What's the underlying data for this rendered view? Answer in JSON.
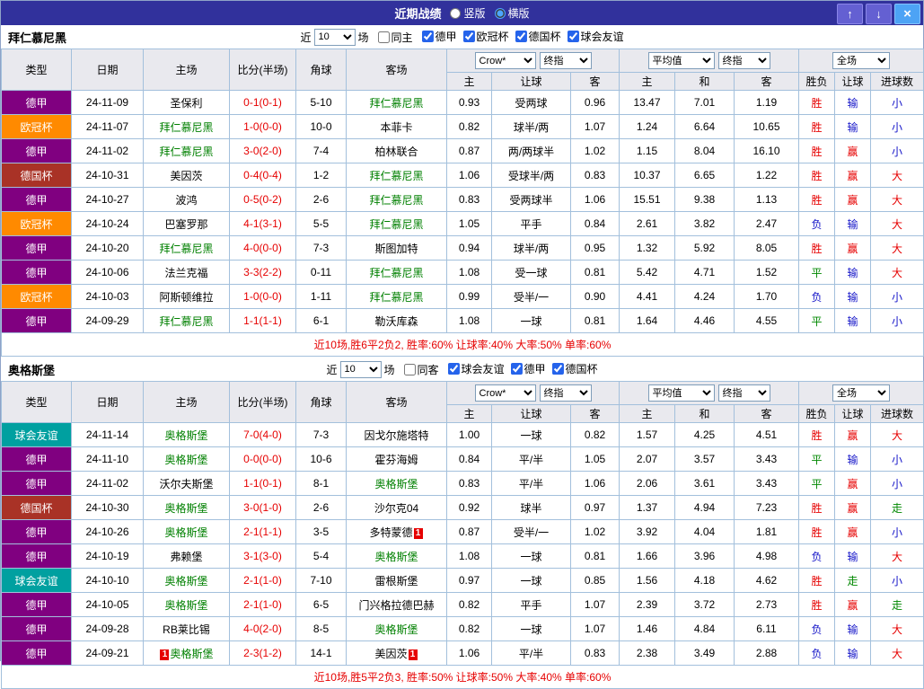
{
  "title_bar": {
    "title": "近期战绩",
    "vertical_label": "竖版",
    "horizontal_label": "横版",
    "selected_layout": "横版",
    "up_icon": "↑",
    "down_icon": "↓",
    "close_icon": "×"
  },
  "colors": {
    "titlebar_bg": "#31319c",
    "score": "#e60000",
    "focus_team": "#008000",
    "summary": "#e60000",
    "league": {
      "德甲": "#800080",
      "欧冠杯": "#ff8a00",
      "德国杯": "#a93226",
      "球会友谊": "#00a0a0"
    },
    "result": {
      "胜": "#e60000",
      "平": "#008800",
      "负": "#1414c8",
      "赢": "#e60000",
      "输": "#1414c8",
      "走": "#008800",
      "大": "#e60000",
      "小": "#1414c8"
    }
  },
  "sections": [
    {
      "team": "拜仁慕尼黑",
      "filter": {
        "near_label": "近",
        "count": "10",
        "games_label": "场",
        "same_label": "同主",
        "same_checked": false,
        "leagues": [
          {
            "label": "德甲",
            "checked": true
          },
          {
            "label": "欧冠杯",
            "checked": true
          },
          {
            "label": "德国杯",
            "checked": true
          },
          {
            "label": "球会友谊",
            "checked": true
          }
        ]
      },
      "header": {
        "main_cols": [
          "类型",
          "日期",
          "主场",
          "比分(半场)",
          "角球",
          "客场"
        ],
        "odds_group1": {
          "source": "Crow*",
          "type": "终指",
          "sub_cols": [
            "主",
            "让球",
            "客"
          ]
        },
        "odds_group2": {
          "source": "平均值",
          "type": "终指",
          "sub_cols": [
            "主",
            "和",
            "客"
          ]
        },
        "result_group": {
          "scope": "全场",
          "sub_cols": [
            "胜负",
            "让球",
            "进球数"
          ]
        }
      },
      "rows": [
        {
          "league": "德甲",
          "date": "24-11-09",
          "home": "圣保利",
          "score": "0-1(0-1)",
          "corner": "5-10",
          "away": "拜仁慕尼黑",
          "o1": "0.93",
          "handicap": "受两球",
          "o2": "0.96",
          "avg_home": "13.47",
          "avg_draw": "7.01",
          "avg_away": "1.19",
          "outcome": "胜",
          "handicap_result": "输",
          "goals_result": "小"
        },
        {
          "league": "欧冠杯",
          "date": "24-11-07",
          "home": "拜仁慕尼黑",
          "score": "1-0(0-0)",
          "corner": "10-0",
          "away": "本菲卡",
          "o1": "0.82",
          "handicap": "球半/两",
          "o2": "1.07",
          "avg_home": "1.24",
          "avg_draw": "6.64",
          "avg_away": "10.65",
          "outcome": "胜",
          "handicap_result": "输",
          "goals_result": "小"
        },
        {
          "league": "德甲",
          "date": "24-11-02",
          "home": "拜仁慕尼黑",
          "score": "3-0(2-0)",
          "corner": "7-4",
          "away": "柏林联合",
          "o1": "0.87",
          "handicap": "两/两球半",
          "o2": "1.02",
          "avg_home": "1.15",
          "avg_draw": "8.04",
          "avg_away": "16.10",
          "outcome": "胜",
          "handicap_result": "赢",
          "goals_result": "小"
        },
        {
          "league": "德国杯",
          "date": "24-10-31",
          "home": "美因茨",
          "score": "0-4(0-4)",
          "corner": "1-2",
          "away": "拜仁慕尼黑",
          "o1": "1.06",
          "handicap": "受球半/两",
          "o2": "0.83",
          "avg_home": "10.37",
          "avg_draw": "6.65",
          "avg_away": "1.22",
          "outcome": "胜",
          "handicap_result": "赢",
          "goals_result": "大"
        },
        {
          "league": "德甲",
          "date": "24-10-27",
          "home": "波鸿",
          "score": "0-5(0-2)",
          "corner": "2-6",
          "away": "拜仁慕尼黑",
          "o1": "0.83",
          "handicap": "受两球半",
          "o2": "1.06",
          "avg_home": "15.51",
          "avg_draw": "9.38",
          "avg_away": "1.13",
          "outcome": "胜",
          "handicap_result": "赢",
          "goals_result": "大"
        },
        {
          "league": "欧冠杯",
          "date": "24-10-24",
          "home": "巴塞罗那",
          "score": "4-1(3-1)",
          "corner": "5-5",
          "away": "拜仁慕尼黑",
          "o1": "1.05",
          "handicap": "平手",
          "o2": "0.84",
          "avg_home": "2.61",
          "avg_draw": "3.82",
          "avg_away": "2.47",
          "outcome": "负",
          "handicap_result": "输",
          "goals_result": "大"
        },
        {
          "league": "德甲",
          "date": "24-10-20",
          "home": "拜仁慕尼黑",
          "score": "4-0(0-0)",
          "corner": "7-3",
          "away": "斯图加特",
          "o1": "0.94",
          "handicap": "球半/两",
          "o2": "0.95",
          "avg_home": "1.32",
          "avg_draw": "5.92",
          "avg_away": "8.05",
          "outcome": "胜",
          "handicap_result": "赢",
          "goals_result": "大"
        },
        {
          "league": "德甲",
          "date": "24-10-06",
          "home": "法兰克福",
          "score": "3-3(2-2)",
          "corner": "0-11",
          "away": "拜仁慕尼黑",
          "o1": "1.08",
          "handicap": "受一球",
          "o2": "0.81",
          "avg_home": "5.42",
          "avg_draw": "4.71",
          "avg_away": "1.52",
          "outcome": "平",
          "handicap_result": "输",
          "goals_result": "大"
        },
        {
          "league": "欧冠杯",
          "date": "24-10-03",
          "home": "阿斯顿维拉",
          "score": "1-0(0-0)",
          "corner": "1-11",
          "away": "拜仁慕尼黑",
          "o1": "0.99",
          "handicap": "受半/一",
          "o2": "0.90",
          "avg_home": "4.41",
          "avg_draw": "4.24",
          "avg_away": "1.70",
          "outcome": "负",
          "handicap_result": "输",
          "goals_result": "小"
        },
        {
          "league": "德甲",
          "date": "24-09-29",
          "home": "拜仁慕尼黑",
          "score": "1-1(1-1)",
          "corner": "6-1",
          "away": "勒沃库森",
          "o1": "1.08",
          "handicap": "一球",
          "o2": "0.81",
          "avg_home": "1.64",
          "avg_draw": "4.46",
          "avg_away": "4.55",
          "outcome": "平",
          "handicap_result": "输",
          "goals_result": "小"
        }
      ],
      "summary": "近10场,胜6平2负2, 胜率:60% 让球率:40% 大率:50% 单率:60%"
    },
    {
      "team": "奥格斯堡",
      "filter": {
        "near_label": "近",
        "count": "10",
        "games_label": "场",
        "same_label": "同客",
        "same_checked": false,
        "leagues": [
          {
            "label": "球会友谊",
            "checked": true
          },
          {
            "label": "德甲",
            "checked": true
          },
          {
            "label": "德国杯",
            "checked": true
          }
        ]
      },
      "header": {
        "main_cols": [
          "类型",
          "日期",
          "主场",
          "比分(半场)",
          "角球",
          "客场"
        ],
        "odds_group1": {
          "source": "Crow*",
          "type": "终指",
          "sub_cols": [
            "主",
            "让球",
            "客"
          ]
        },
        "odds_group2": {
          "source": "平均值",
          "type": "终指",
          "sub_cols": [
            "主",
            "和",
            "客"
          ]
        },
        "result_group": {
          "scope": "全场",
          "sub_cols": [
            "胜负",
            "让球",
            "进球数"
          ]
        }
      },
      "rows": [
        {
          "league": "球会友谊",
          "date": "24-11-14",
          "home": "奥格斯堡",
          "score": "7-0(4-0)",
          "corner": "7-3",
          "away": "因戈尔施塔特",
          "o1": "1.00",
          "handicap": "一球",
          "o2": "0.82",
          "avg_home": "1.57",
          "avg_draw": "4.25",
          "avg_away": "4.51",
          "outcome": "胜",
          "handicap_result": "赢",
          "goals_result": "大"
        },
        {
          "league": "德甲",
          "date": "24-11-10",
          "home": "奥格斯堡",
          "score": "0-0(0-0)",
          "corner": "10-6",
          "away": "霍芬海姆",
          "o1": "0.84",
          "handicap": "平/半",
          "o2": "1.05",
          "avg_home": "2.07",
          "avg_draw": "3.57",
          "avg_away": "3.43",
          "outcome": "平",
          "handicap_result": "输",
          "goals_result": "小"
        },
        {
          "league": "德甲",
          "date": "24-11-02",
          "home": "沃尔夫斯堡",
          "score": "1-1(0-1)",
          "corner": "8-1",
          "away": "奥格斯堡",
          "o1": "0.83",
          "handicap": "平/半",
          "o2": "1.06",
          "avg_home": "2.06",
          "avg_draw": "3.61",
          "avg_away": "3.43",
          "outcome": "平",
          "handicap_result": "赢",
          "goals_result": "小"
        },
        {
          "league": "德国杯",
          "date": "24-10-30",
          "home": "奥格斯堡",
          "score": "3-0(1-0)",
          "corner": "2-6",
          "away": "沙尔克04",
          "o1": "0.92",
          "handicap": "球半",
          "o2": "0.97",
          "avg_home": "1.37",
          "avg_draw": "4.94",
          "avg_away": "7.23",
          "outcome": "胜",
          "handicap_result": "赢",
          "goals_result": "走"
        },
        {
          "league": "德甲",
          "date": "24-10-26",
          "home": "奥格斯堡",
          "score": "2-1(1-1)",
          "corner": "3-5",
          "away": "多特蒙德",
          "away_card": "1",
          "o1": "0.87",
          "handicap": "受半/一",
          "o2": "1.02",
          "avg_home": "3.92",
          "avg_draw": "4.04",
          "avg_away": "1.81",
          "outcome": "胜",
          "handicap_result": "赢",
          "goals_result": "小"
        },
        {
          "league": "德甲",
          "date": "24-10-19",
          "home": "弗赖堡",
          "score": "3-1(3-0)",
          "corner": "5-4",
          "away": "奥格斯堡",
          "o1": "1.08",
          "handicap": "一球",
          "o2": "0.81",
          "avg_home": "1.66",
          "avg_draw": "3.96",
          "avg_away": "4.98",
          "outcome": "负",
          "handicap_result": "输",
          "goals_result": "大"
        },
        {
          "league": "球会友谊",
          "date": "24-10-10",
          "home": "奥格斯堡",
          "score": "2-1(1-0)",
          "corner": "7-10",
          "away": "雷根斯堡",
          "o1": "0.97",
          "handicap": "一球",
          "o2": "0.85",
          "avg_home": "1.56",
          "avg_draw": "4.18",
          "avg_away": "4.62",
          "outcome": "胜",
          "handicap_result": "走",
          "goals_result": "小"
        },
        {
          "league": "德甲",
          "date": "24-10-05",
          "home": "奥格斯堡",
          "score": "2-1(1-0)",
          "corner": "6-5",
          "away": "门兴格拉德巴赫",
          "o1": "0.82",
          "handicap": "平手",
          "o2": "1.07",
          "avg_home": "2.39",
          "avg_draw": "3.72",
          "avg_away": "2.73",
          "outcome": "胜",
          "handicap_result": "赢",
          "goals_result": "走"
        },
        {
          "league": "德甲",
          "date": "24-09-28",
          "home": "RB莱比锡",
          "score": "4-0(2-0)",
          "corner": "8-5",
          "away": "奥格斯堡",
          "o1": "0.82",
          "handicap": "一球",
          "o2": "1.07",
          "avg_home": "1.46",
          "avg_draw": "4.84",
          "avg_away": "6.11",
          "outcome": "负",
          "handicap_result": "输",
          "goals_result": "大"
        },
        {
          "league": "德甲",
          "date": "24-09-21",
          "home": "奥格斯堡",
          "home_card": "1",
          "score": "2-3(1-2)",
          "corner": "14-1",
          "away": "美因茨",
          "away_card": "1",
          "o1": "1.06",
          "handicap": "平/半",
          "o2": "0.83",
          "avg_home": "2.38",
          "avg_draw": "3.49",
          "avg_away": "2.88",
          "outcome": "负",
          "handicap_result": "输",
          "goals_result": "大"
        }
      ],
      "summary": "近10场,胜5平2负3, 胜率:50% 让球率:50% 大率:40% 单率:60%"
    }
  ]
}
